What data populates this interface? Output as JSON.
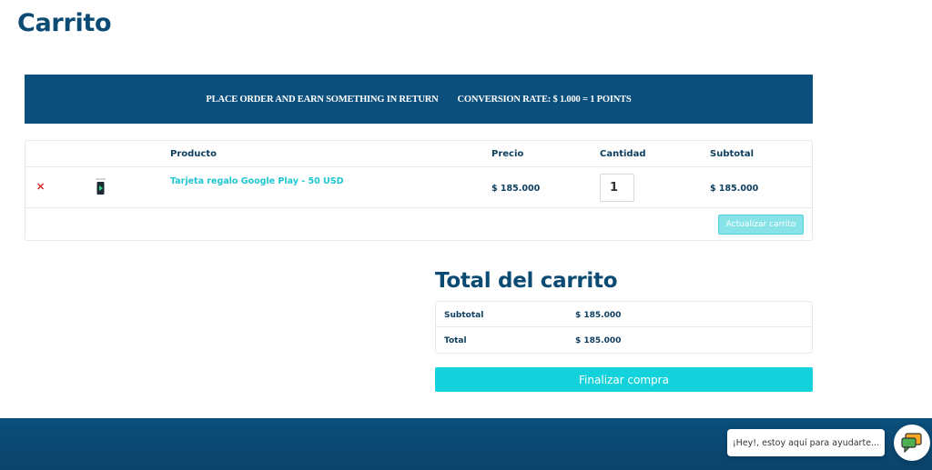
{
  "page": {
    "title": "Carrito"
  },
  "promo": {
    "left_text": "PLACE ORDER AND EARN SOMETHING IN RETURN",
    "right_text": "CONVERSION RATE: $ 1.000 = 1 POINTS"
  },
  "cart": {
    "headers": {
      "product": "Producto",
      "price": "Precio",
      "quantity": "Cantidad",
      "subtotal": "Subtotal"
    },
    "items": [
      {
        "remove_icon": "close-icon",
        "thumbnail_icon": "gift-card-icon",
        "name": "Tarjeta regalo Google Play - 50 USD",
        "price": "$ 185.000",
        "quantity": "1",
        "subtotal": "$ 185.000"
      }
    ],
    "update_label": "Actualizar carrito"
  },
  "totals": {
    "title": "Total del carrito",
    "subtotal_label": "Subtotal",
    "subtotal_value": "$ 185.000",
    "total_label": "Total",
    "total_value": "$ 185.000"
  },
  "checkout": {
    "label": "Finalizar compra"
  },
  "chat": {
    "bubble_text": "¡Hey!, estoy aquí para ayudarte...",
    "launcher_icon": "chat-icon"
  },
  "colors": {
    "brand": "#0b4f7c",
    "accent": "#13d2db",
    "remove": "#d92b2b"
  }
}
